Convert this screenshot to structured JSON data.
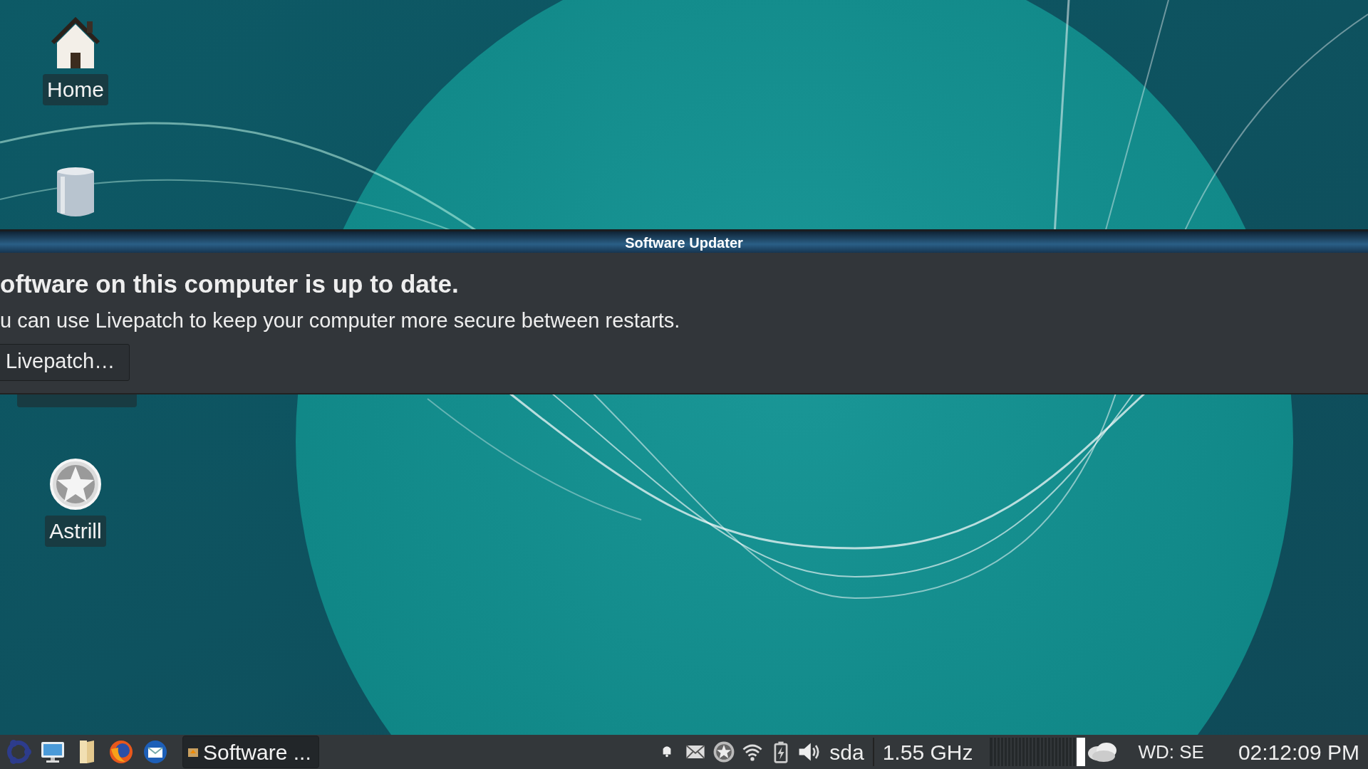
{
  "desktop_icons": [
    {
      "kind": "home",
      "label": "Home"
    },
    {
      "kind": "trash"
    },
    {
      "kind": "star",
      "label": "Astrill"
    }
  ],
  "dialog": {
    "title": "Software Updater",
    "heading": "oftware on this computer is up to date.",
    "message": "u can use Livepatch to keep your computer more secure between restarts.",
    "buttons": [
      "Livepatch…"
    ]
  },
  "taskbar": {
    "launchers": [
      {
        "kind": "menu"
      },
      {
        "kind": "monitor"
      },
      {
        "kind": "folder"
      },
      {
        "kind": "browser"
      },
      {
        "kind": "mail"
      }
    ],
    "tasks": [
      {
        "label": "Software ...",
        "selected": true
      }
    ],
    "tray": [
      {
        "kind": "bell"
      },
      {
        "kind": "envelope"
      },
      {
        "kind": "star"
      },
      {
        "kind": "wifi"
      },
      {
        "kind": "battery"
      },
      {
        "kind": "speaker"
      }
    ],
    "disk": "sda",
    "cpu_freq": "1.55 GHz",
    "weather": "WD: SE",
    "clock": "02:12:09 PM"
  }
}
